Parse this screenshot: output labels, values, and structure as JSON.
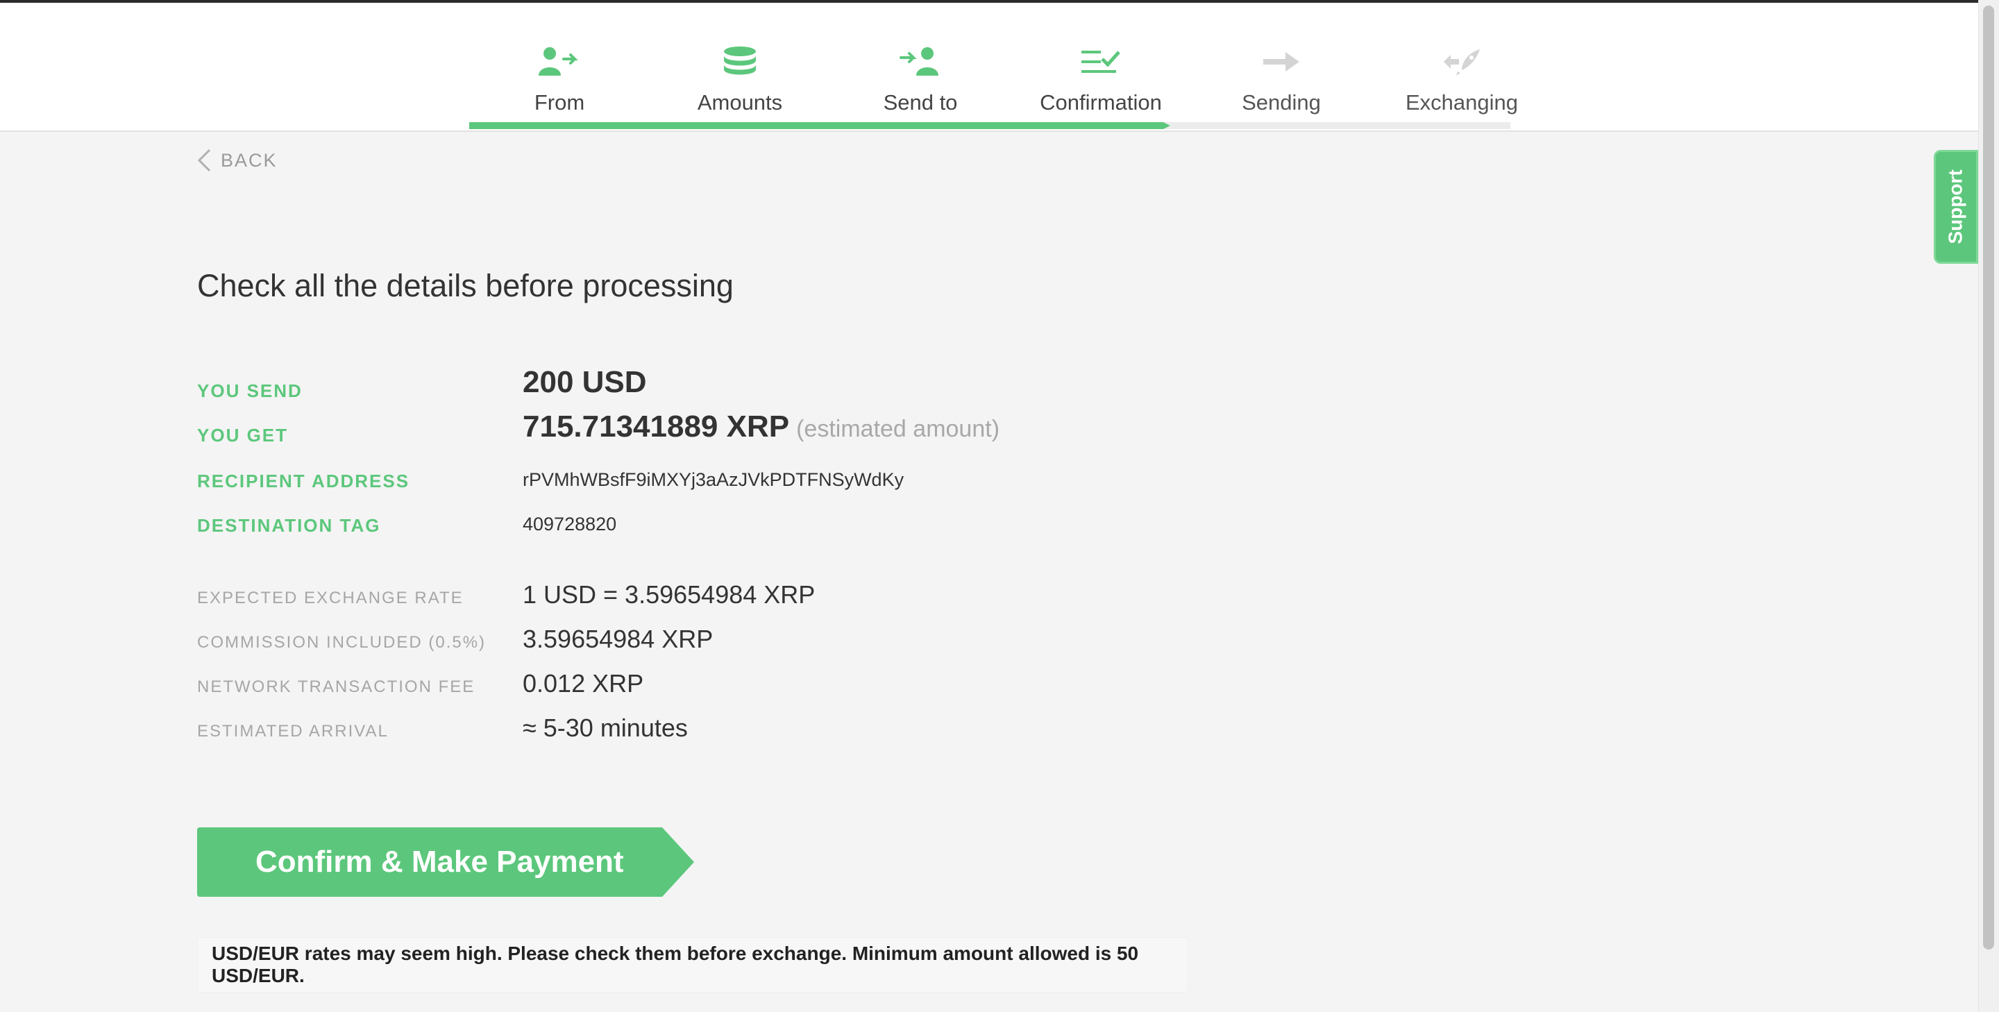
{
  "steps": [
    {
      "label": "From",
      "icon": "user-arrow-icon",
      "active": true
    },
    {
      "label": "Amounts",
      "icon": "coins-stack-icon",
      "active": true
    },
    {
      "label": "Send to",
      "icon": "arrow-user-icon",
      "active": true
    },
    {
      "label": "Confirmation",
      "icon": "list-check-icon",
      "active": true
    },
    {
      "label": "Sending",
      "icon": "arrow-right-icon",
      "active": false
    },
    {
      "label": "Exchanging",
      "icon": "rocket-exchange-icon",
      "active": false
    }
  ],
  "progress": {
    "completed_steps": 4,
    "total_steps": 6
  },
  "back_label": "BACK",
  "title": "Check all the details before processing",
  "details": {
    "you_send": {
      "label": "YOU SEND",
      "value": "200 USD"
    },
    "you_get": {
      "label": "YOU GET",
      "value": "715.71341889 XRP",
      "note": "(estimated amount)"
    },
    "recipient": {
      "label": "RECIPIENT ADDRESS",
      "value": "rPVMhWBsfF9iMXYj3aAzJVkPDTFNSyWdKy"
    },
    "destination_tag": {
      "label": "DESTINATION TAG",
      "value": "409728820"
    },
    "rate": {
      "label": "EXPECTED EXCHANGE RATE",
      "value": "1 USD = 3.59654984 XRP"
    },
    "commission": {
      "label": "COMMISSION INCLUDED (0.5%)",
      "value": "3.59654984 XRP"
    },
    "fee": {
      "label": "NETWORK TRANSACTION FEE",
      "value": "0.012 XRP"
    },
    "arrival": {
      "label": "ESTIMATED ARRIVAL",
      "value": "≈ 5-30 minutes"
    }
  },
  "confirm_button": "Confirm & Make Payment",
  "notice": "USD/EUR rates may seem high. Please check them before exchange. Minimum amount allowed is 50 USD/EUR.",
  "support_label": "Support",
  "colors": {
    "accent": "#5cc77c",
    "inactive_icon": "#d0d0d0",
    "background": "#f4f4f4"
  }
}
